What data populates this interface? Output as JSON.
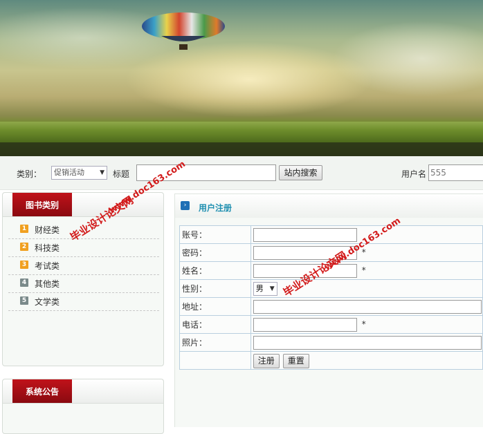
{
  "toolbar": {
    "category_label": "类别：",
    "category_value": "促销活动",
    "title_label": "标题",
    "search_button": "站内搜索",
    "username_label": "用户名",
    "username_value": "555"
  },
  "book_categories": {
    "title": "图书类别",
    "items": [
      {
        "num": "1",
        "label": "财经类",
        "color": "#f0a020"
      },
      {
        "num": "2",
        "label": "科技类",
        "color": "#f0a020"
      },
      {
        "num": "3",
        "label": "考试类",
        "color": "#f0a020"
      },
      {
        "num": "4",
        "label": "其他类",
        "color": "#7a8a8a"
      },
      {
        "num": "5",
        "label": "文学类",
        "color": "#7a8a8a"
      }
    ]
  },
  "announcements": {
    "title": "系统公告"
  },
  "register": {
    "title": "用户注册",
    "fields": {
      "account": "账号：",
      "password": "密码：",
      "name": "姓名：",
      "gender": "性别：",
      "address": "地址：",
      "phone": "电话：",
      "photo": "照片："
    },
    "required_mark": "*",
    "gender_value": "男",
    "submit_button": "注册",
    "reset_button": "重置"
  },
  "watermark": {
    "site_cn": "毕业设计论文网",
    "site_url": "www.doc163.com"
  },
  "colors": {
    "tab_red": "#a50e14",
    "title_blue": "#1f8fb0",
    "watermark_red": "#d21b1b"
  }
}
